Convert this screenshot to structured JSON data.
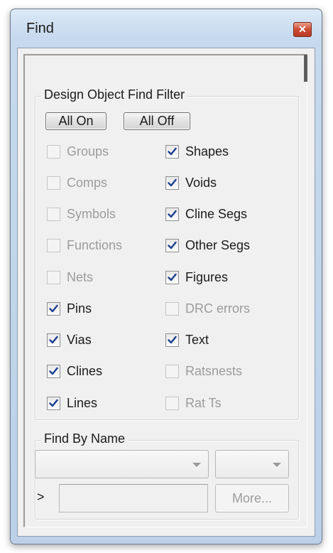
{
  "window": {
    "title": "Find",
    "close_glyph": "✕"
  },
  "filter_group": {
    "label": "Design Object Find Filter",
    "all_on_label": "All On",
    "all_off_label": "All Off",
    "left_column": [
      {
        "label": "Groups",
        "checked": false,
        "enabled": false
      },
      {
        "label": "Comps",
        "checked": false,
        "enabled": false
      },
      {
        "label": "Symbols",
        "checked": false,
        "enabled": false
      },
      {
        "label": "Functions",
        "checked": false,
        "enabled": false
      },
      {
        "label": "Nets",
        "checked": false,
        "enabled": false
      },
      {
        "label": "Pins",
        "checked": true,
        "enabled": true
      },
      {
        "label": "Vias",
        "checked": true,
        "enabled": true
      },
      {
        "label": "Clines",
        "checked": true,
        "enabled": true
      },
      {
        "label": "Lines",
        "checked": true,
        "enabled": true
      }
    ],
    "right_column": [
      {
        "label": "Shapes",
        "checked": true,
        "enabled": true
      },
      {
        "label": "Voids",
        "checked": true,
        "enabled": true
      },
      {
        "label": "Cline Segs",
        "checked": true,
        "enabled": true
      },
      {
        "label": "Other Segs",
        "checked": true,
        "enabled": true
      },
      {
        "label": "Figures",
        "checked": true,
        "enabled": true
      },
      {
        "label": "DRC errors",
        "checked": false,
        "enabled": false
      },
      {
        "label": "Text",
        "checked": true,
        "enabled": true
      },
      {
        "label": "Ratsnests",
        "checked": false,
        "enabled": false
      },
      {
        "label": "Rat Ts",
        "checked": false,
        "enabled": false
      }
    ]
  },
  "find_by_name": {
    "label": "Find By Name",
    "type_select_value": "",
    "mode_select_value": "",
    "prompt_glyph": ">",
    "name_value": "",
    "more_label": "More..."
  },
  "colors": {
    "check_mark": "#1a3f8f",
    "title_bar": "#c6d9ee",
    "close_button": "#cf4b33"
  }
}
